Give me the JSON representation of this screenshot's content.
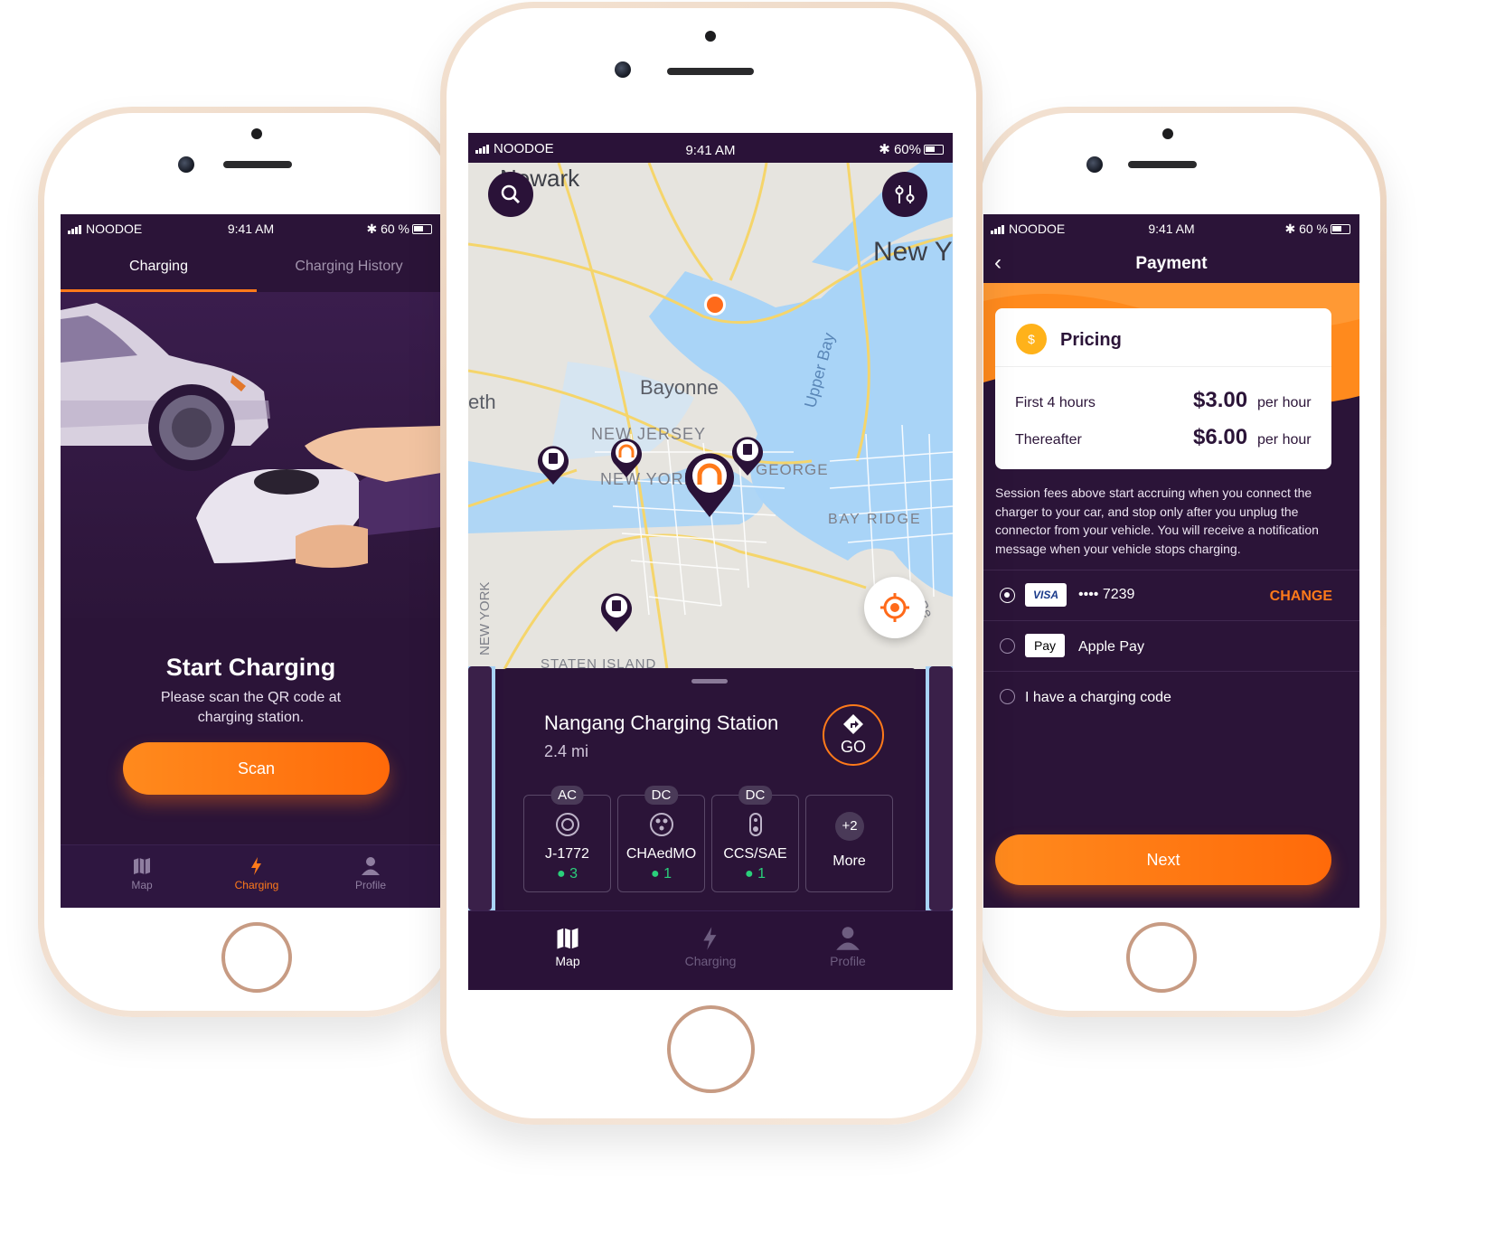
{
  "status": {
    "carrier": "NOODOE",
    "time": "9:41 AM",
    "battery_left": "60 %",
    "battery_center": "60%",
    "battery_right": "60 %"
  },
  "left": {
    "tabs": [
      "Charging",
      "Charging History"
    ],
    "title": "Start Charging",
    "subtitle": "Please scan the QR code at charging station.",
    "scan_button": "Scan",
    "nav": [
      "Map",
      "Charging",
      "Profile"
    ]
  },
  "center": {
    "map_labels": {
      "newark": "Newark",
      "new_york": "New Y",
      "bayonne": "Bayonne",
      "new_jersey": "NEW JERSEY",
      "new_york_state": "NEW YORK",
      "george": "GEORGE",
      "upper_bay": "Upper Bay",
      "bay_ridge": "BAY RIDGE",
      "staten_island": "STATEN ISLAND",
      "eth": "eth",
      "new_york_vertical": "NEW YORK",
      "be": "Be"
    },
    "station": {
      "name": "Nangang Charging Station",
      "distance": "2.4 mi",
      "go": "GO"
    },
    "connectors": [
      {
        "type": "AC",
        "name": "J-1772",
        "count": "3"
      },
      {
        "type": "DC",
        "name": "CHAedMO",
        "count": "1"
      },
      {
        "type": "DC",
        "name": "CCS/SAE",
        "count": "1"
      }
    ],
    "more": {
      "count": "+2",
      "label": "More"
    },
    "nav": [
      "Map",
      "Charging",
      "Profile"
    ]
  },
  "right": {
    "title": "Payment",
    "pricing": {
      "heading": "Pricing",
      "rows": [
        {
          "label": "First 4 hours",
          "price": "$3.00",
          "unit": "per hour"
        },
        {
          "label": "Thereafter",
          "price": "$6.00",
          "unit": "per hour"
        }
      ]
    },
    "note": "Session fees above start accruing when you connect the charger to your car, and stop only after you unplug the connector from your vehicle. You will receive a notification message when your vehicle stops charging.",
    "methods": [
      {
        "logo": "VISA",
        "label": "•••• 7239",
        "action": "CHANGE"
      },
      {
        "logo": "Pay",
        "label": "Apple Pay"
      },
      {
        "label": "I have a charging code"
      }
    ],
    "next_button": "Next"
  },
  "colors": {
    "accent": "#ff7a1a",
    "purple": "#2b1438",
    "green": "#2ad07b"
  }
}
